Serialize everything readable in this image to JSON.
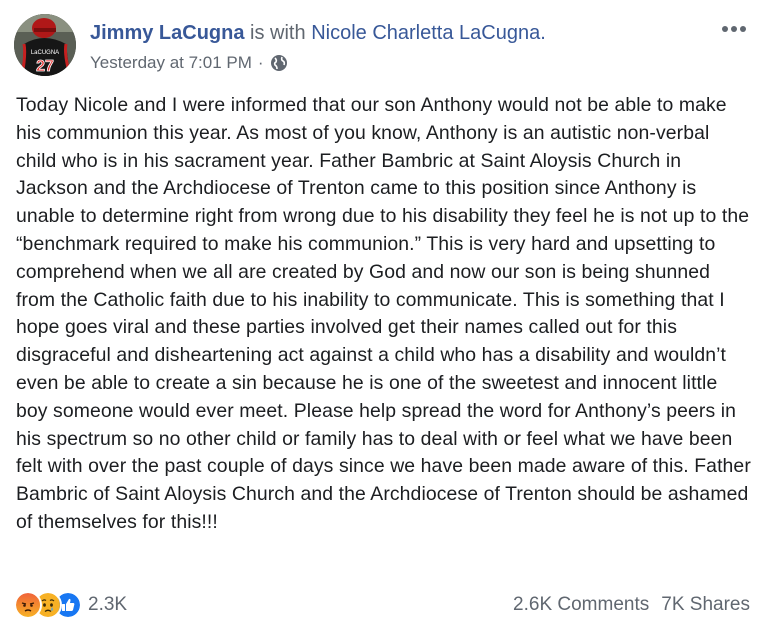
{
  "post": {
    "author": "Jimmy LaCugna",
    "with_text": "is with",
    "tagged": "Nicole Charletta LaCugna.",
    "timestamp": "Yesterday at 7:01 PM",
    "separator": "·",
    "privacy_icon": "globe-icon",
    "more_icon": "more-options-icon",
    "avatar": {
      "jersey_number": "27",
      "jersey_name": "LaCUGNA"
    },
    "body": "Today Nicole and I were informed that our son Anthony would not be able to make his communion this year. As most of you know, Anthony is an autistic non-verbal child who is in his sacrament year. Father Bambric at Saint Aloysis Church in Jackson and the Archdiocese of Trenton came to this position since Anthony is unable to determine right from wrong due to his disability they feel he is not up to the “benchmark required to make his communion.” This is very hard and upsetting to comprehend when we all are created by God and now our son is being shunned from the Catholic faith due to his inability to communicate. This is something that I hope goes viral and these parties involved get their names called out for this disgraceful and disheartening act against a child who has a disability and wouldn’t even be able to create a sin because he is one of the sweetest and innocent little boy someone would ever meet. Please help spread the word for Anthony’s peers in his spectrum so no other child or family has to deal with or feel what we have been felt with over the past couple of days since we have been made aware of this. Father Bambric of Saint Aloysis Church and the Archdiocese of Trenton should be ashamed of themselves for this!!!"
  },
  "footer": {
    "reactions": [
      "angry-reaction-icon",
      "sad-reaction-icon",
      "like-reaction-icon"
    ],
    "reaction_count": "2.3K",
    "comments": "2.6K Comments",
    "shares": "7K Shares"
  },
  "colors": {
    "link": "#385898",
    "secondary_text": "#606770",
    "body_text": "#1c1e21",
    "like_blue": "#1877f2",
    "angry_orange": "#f0633a",
    "sad_yellow": "#f7b125"
  }
}
